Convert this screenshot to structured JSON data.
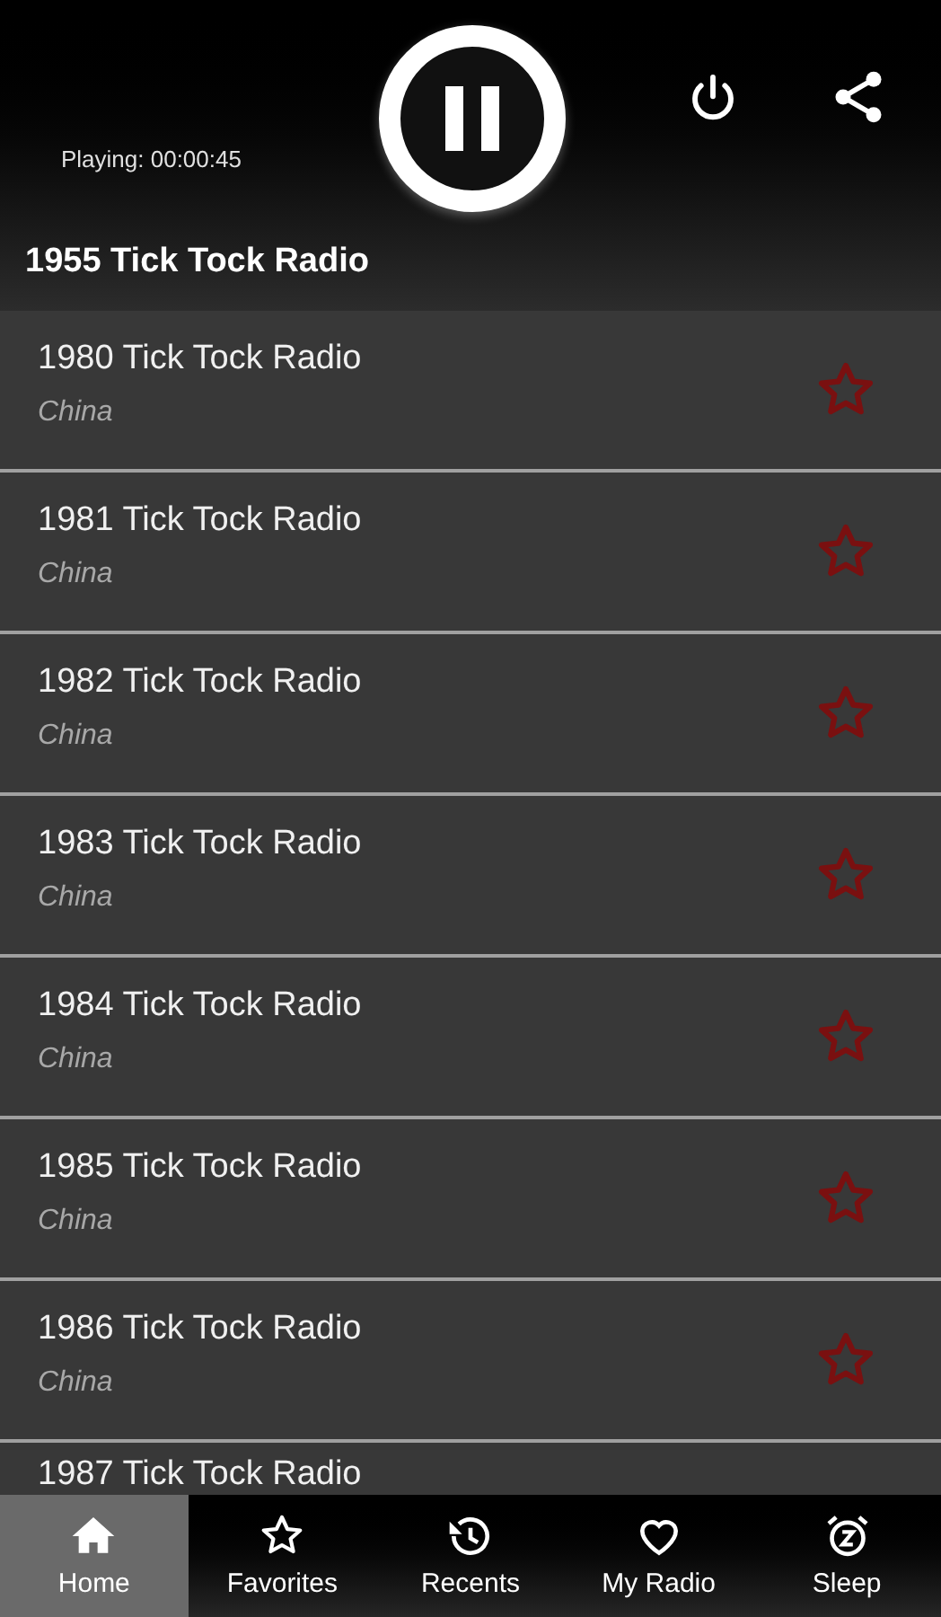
{
  "player": {
    "elapsed": "Playing: 00:00:45",
    "now_playing": "1955 Tick Tock Radio"
  },
  "stations": [
    {
      "name": "1980 Tick Tock Radio",
      "country": "China",
      "favorite": false
    },
    {
      "name": "1981 Tick Tock Radio",
      "country": "China",
      "favorite": false
    },
    {
      "name": "1982 Tick Tock Radio",
      "country": "China",
      "favorite": false
    },
    {
      "name": "1983 Tick Tock Radio",
      "country": "China",
      "favorite": false
    },
    {
      "name": "1984 Tick Tock Radio",
      "country": "China",
      "favorite": false
    },
    {
      "name": "1985 Tick Tock Radio",
      "country": "China",
      "favorite": false
    },
    {
      "name": "1986 Tick Tock Radio",
      "country": "China",
      "favorite": false
    },
    {
      "name": "1987 Tick Tock Radio"
    }
  ],
  "nav": [
    {
      "kind": "home",
      "label": "Home",
      "selected": true
    },
    {
      "kind": "favorites",
      "label": "Favorites",
      "selected": false
    },
    {
      "kind": "recents",
      "label": "Recents",
      "selected": false
    },
    {
      "kind": "myradio",
      "label": "My Radio",
      "selected": false
    },
    {
      "kind": "sleep",
      "label": "Sleep",
      "selected": false
    }
  ]
}
